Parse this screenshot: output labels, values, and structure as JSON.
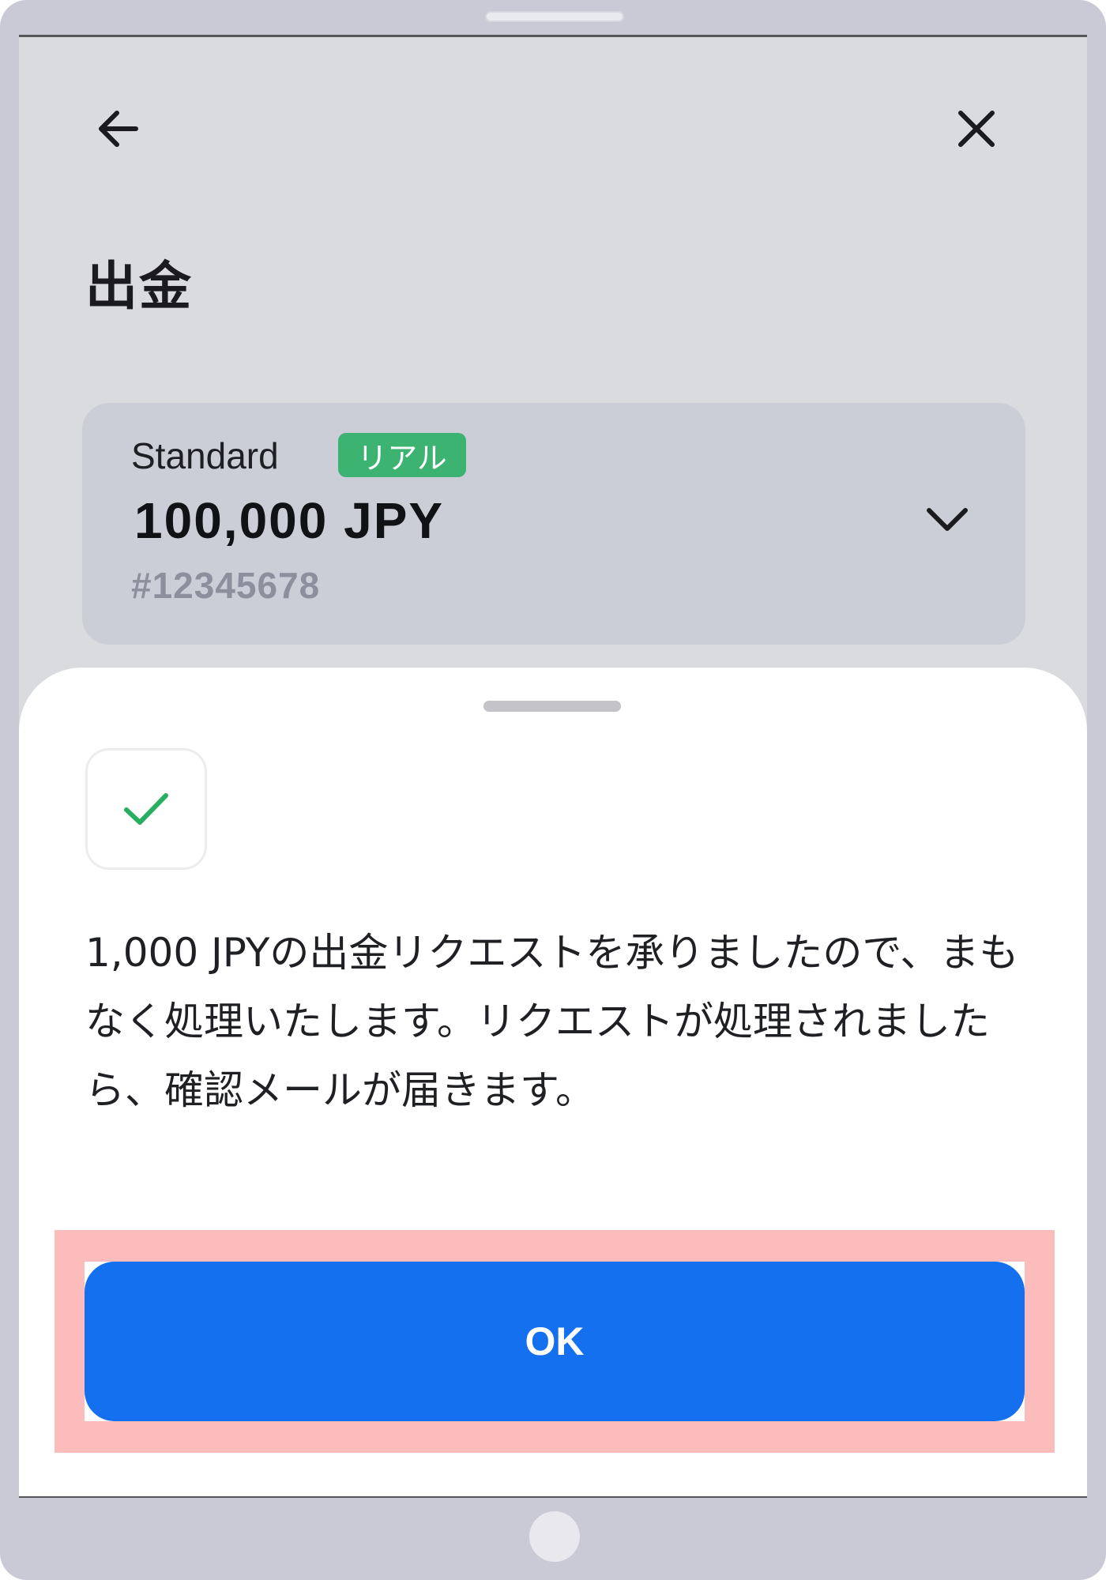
{
  "header": {
    "back_icon": "arrow-left-icon",
    "close_icon": "close-icon",
    "title": "出金"
  },
  "account": {
    "type": "Standard",
    "badge": "リアル",
    "balance": "100,000 JPY",
    "number": "#12345678",
    "dropdown_icon": "chevron-down-icon"
  },
  "sheet": {
    "status_icon": "check-icon",
    "message": "1,000 JPYの出金リクエストを承りましたので、まもなく処理いたします。リクエストが処理されましたら、確認メールが届きます。",
    "ok_label": "OK"
  },
  "colors": {
    "badge": "#3cb371",
    "ok_button": "#1570ef",
    "check": "#27ae60",
    "highlight": "#fcbcbc"
  }
}
